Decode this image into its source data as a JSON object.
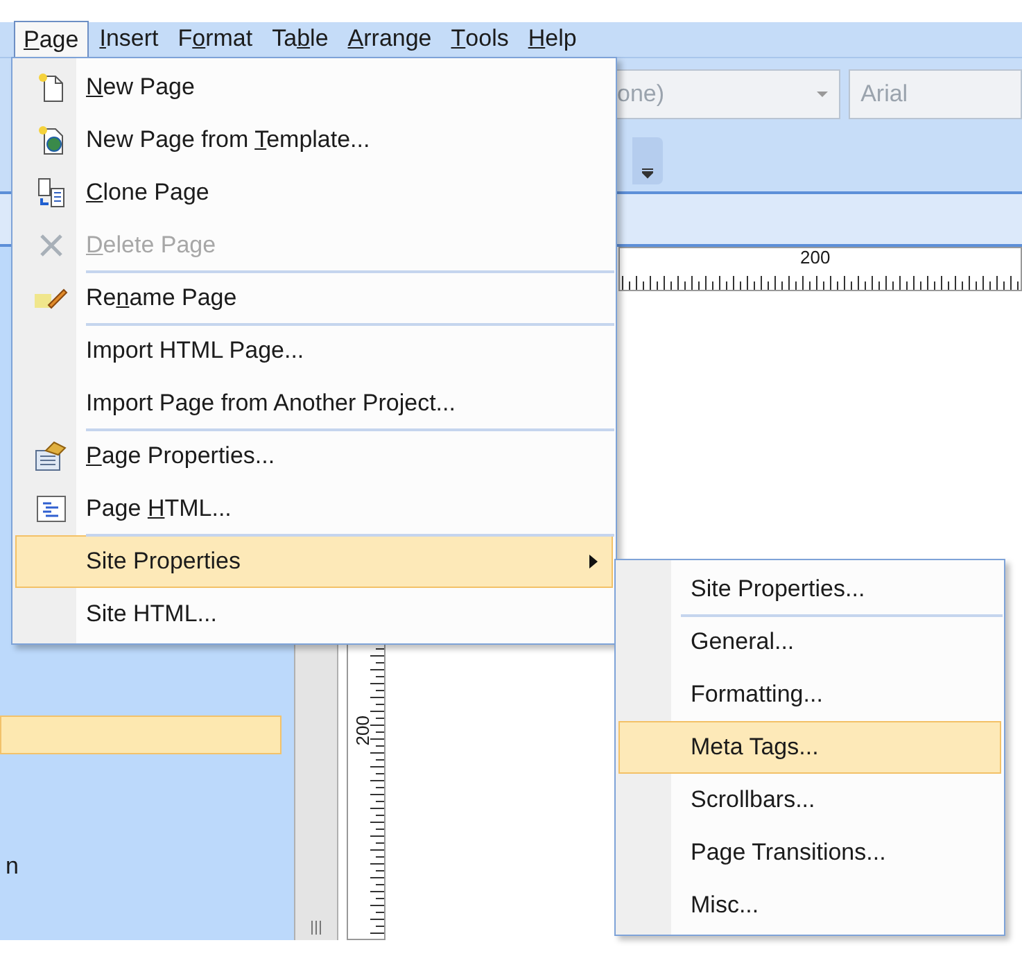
{
  "menubar": [
    {
      "key": "P",
      "post": "age",
      "selected": true
    },
    {
      "key": "I",
      "post": "nsert",
      "selected": false
    },
    {
      "pre": "F",
      "key": "o",
      "post": "rmat",
      "selected": false
    },
    {
      "pre": "Ta",
      "key": "b",
      "post": "le",
      "selected": false
    },
    {
      "key": "A",
      "post": "rrange",
      "selected": false
    },
    {
      "key": "T",
      "post": "ools",
      "selected": false
    },
    {
      "key": "H",
      "post": "elp",
      "selected": false
    }
  ],
  "toolbar": {
    "style_combo": "one)",
    "font_combo": "Arial"
  },
  "ruler": {
    "horizontal_label": "200",
    "vertical_label": "200"
  },
  "side_panel": {
    "text": "n"
  },
  "page_menu": [
    {
      "key": "N",
      "post": "ew Page",
      "disabled": false,
      "selected": false,
      "submenu": false,
      "divider_above": false
    },
    {
      "pre": "New Page from ",
      "key": "T",
      "post": "emplate...",
      "disabled": false,
      "selected": false,
      "submenu": false,
      "divider_above": false
    },
    {
      "key": "C",
      "post": "lone Page",
      "disabled": false,
      "selected": false,
      "submenu": false,
      "divider_above": false
    },
    {
      "key": "D",
      "post": "elete Page",
      "disabled": true,
      "selected": false,
      "submenu": false,
      "divider_above": false
    },
    {
      "pre": "Re",
      "key": "n",
      "post": "ame Page",
      "disabled": false,
      "selected": false,
      "submenu": false,
      "divider_above": true
    },
    {
      "pre": "Import HTML Page...",
      "disabled": false,
      "selected": false,
      "submenu": false,
      "divider_above": true
    },
    {
      "pre": "Import Page from Another Project...",
      "disabled": false,
      "selected": false,
      "submenu": false,
      "divider_above": false
    },
    {
      "key": "P",
      "post": "age Properties...",
      "disabled": false,
      "selected": false,
      "submenu": false,
      "divider_above": true
    },
    {
      "pre": "Page ",
      "key": "H",
      "post": "TML...",
      "disabled": false,
      "selected": false,
      "submenu": false,
      "divider_above": false
    },
    {
      "pre": "Site Properties",
      "disabled": false,
      "selected": true,
      "submenu": true,
      "divider_above": true
    },
    {
      "pre": "Site HTML...",
      "disabled": false,
      "selected": false,
      "submenu": false,
      "divider_above": false
    }
  ],
  "site_properties_submenu": [
    {
      "label": "Site Properties...",
      "selected": false,
      "divider_above": false
    },
    {
      "label": "General...",
      "selected": false,
      "divider_above": true
    },
    {
      "label": "Formatting...",
      "selected": false,
      "divider_above": false
    },
    {
      "label": "Meta Tags...",
      "selected": true,
      "divider_above": false
    },
    {
      "label": "Scrollbars...",
      "selected": false,
      "divider_above": false
    },
    {
      "label": "Page Transitions...",
      "selected": false,
      "divider_above": false
    },
    {
      "label": "Misc...",
      "selected": false,
      "divider_above": false
    }
  ]
}
